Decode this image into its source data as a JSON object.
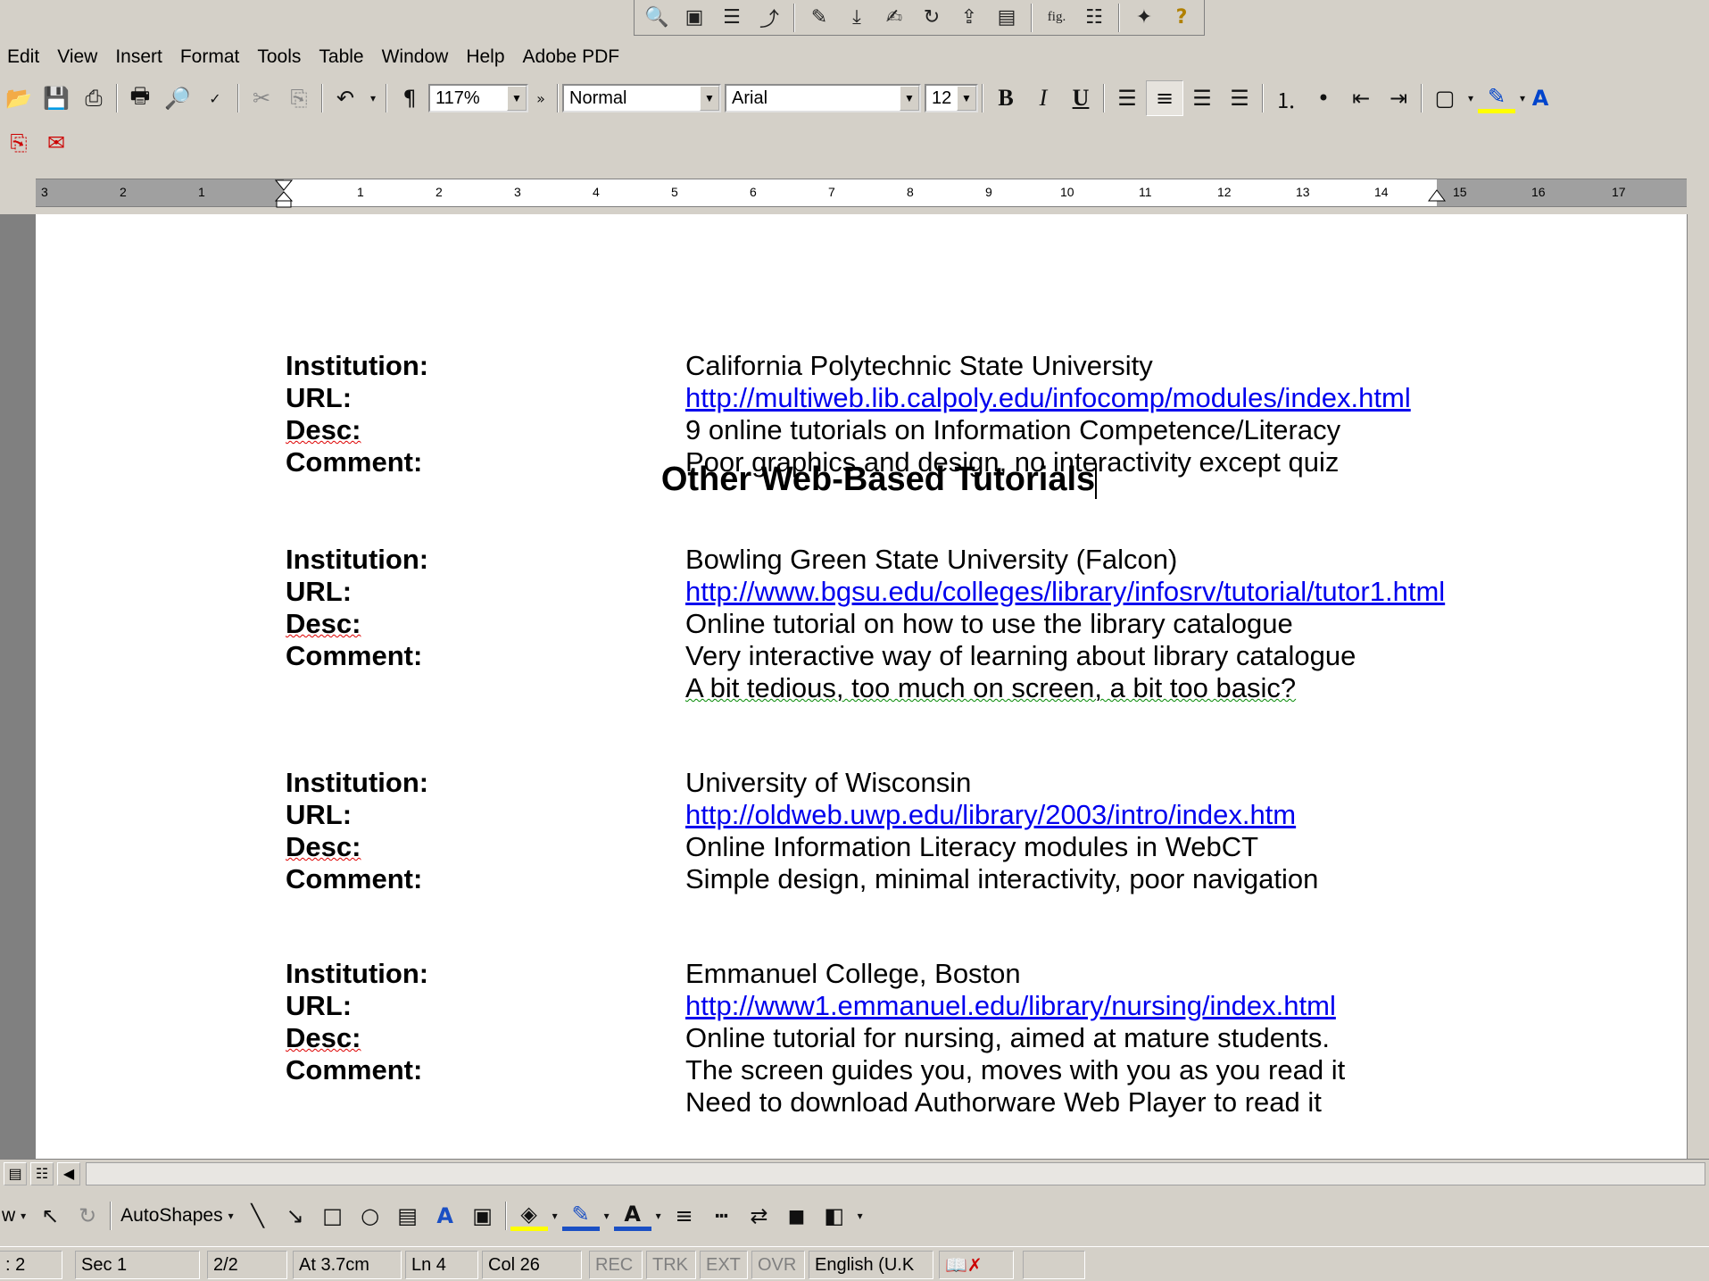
{
  "top_toolbar": {
    "icons": [
      "magnifier-icon",
      "image-icon",
      "list-icon",
      "arrow-tool-icon",
      "pen-icon",
      "download-icon",
      "edit-icon",
      "refresh-icon",
      "export-icon",
      "notes-icon",
      "fig-icon",
      "outline-icon",
      "tools-icon",
      "help-icon"
    ],
    "fig_label": "fig."
  },
  "menubar": {
    "items": [
      "Edit",
      "View",
      "Insert",
      "Format",
      "Tools",
      "Table",
      "Window",
      "Help",
      "Adobe PDF"
    ]
  },
  "formatting": {
    "zoom": "117%",
    "style": "Normal",
    "font": "Arial",
    "size": "12",
    "bold": "B",
    "italic": "I",
    "underline": "U",
    "paragraph_mark": "¶"
  },
  "ruler": {
    "numbers": [
      "3",
      "2",
      "1",
      "1",
      "2",
      "3",
      "4",
      "5",
      "6",
      "7",
      "8",
      "9",
      "10",
      "11",
      "12",
      "13",
      "14",
      "15",
      "16",
      "17"
    ]
  },
  "document": {
    "title": "Other Web-Based Tutorials",
    "labels": {
      "institution": "Institution:",
      "url": "URL:",
      "desc": "Desc:",
      "comment": "Comment:"
    },
    "entries": [
      {
        "institution": "California Polytechnic State University",
        "url": "http://multiweb.lib.calpoly.edu/infocomp/modules/index.html",
        "desc": "9 online tutorials on Information Competence/Literacy",
        "comment": "Poor graphics and design, no interactivity except quiz",
        "comment2": ""
      },
      {
        "institution": "Bowling Green State University (Falcon)",
        "url": "http://www.bgsu.edu/colleges/library/infosrv/tutorial/tutor1.html",
        "desc": "Online tutorial on how to use the library catalogue",
        "comment": "Very interactive way of learning about library catalogue",
        "comment2": "A bit tedious, too much on screen, a bit too basic?"
      },
      {
        "institution": "University of Wisconsin",
        "url": "http://oldweb.uwp.edu/library/2003/intro/index.htm",
        "desc": "Online Information Literacy modules in WebCT",
        "comment": "Simple design, minimal interactivity, poor navigation",
        "comment2": ""
      },
      {
        "institution": "Emmanuel College, Boston",
        "url": "http://www1.emmanuel.edu/library/nursing/index.html",
        "desc": "Online tutorial for nursing, aimed at mature students.",
        "comment": "The screen guides you, moves with you as you read it",
        "comment2": "Need to download Authorware Web Player to read it"
      }
    ]
  },
  "drawbar": {
    "draw_label": "w",
    "autoshapes": "AutoShapes"
  },
  "status": {
    "page": ": 2",
    "sec": "Sec 1",
    "pages": "2/2",
    "at": "At 3.7cm",
    "ln": "Ln 4",
    "col": "Col 26",
    "rec": "REC",
    "trk": "TRK",
    "ext": "EXT",
    "ovr": "OVR",
    "language": "English (U.K"
  }
}
